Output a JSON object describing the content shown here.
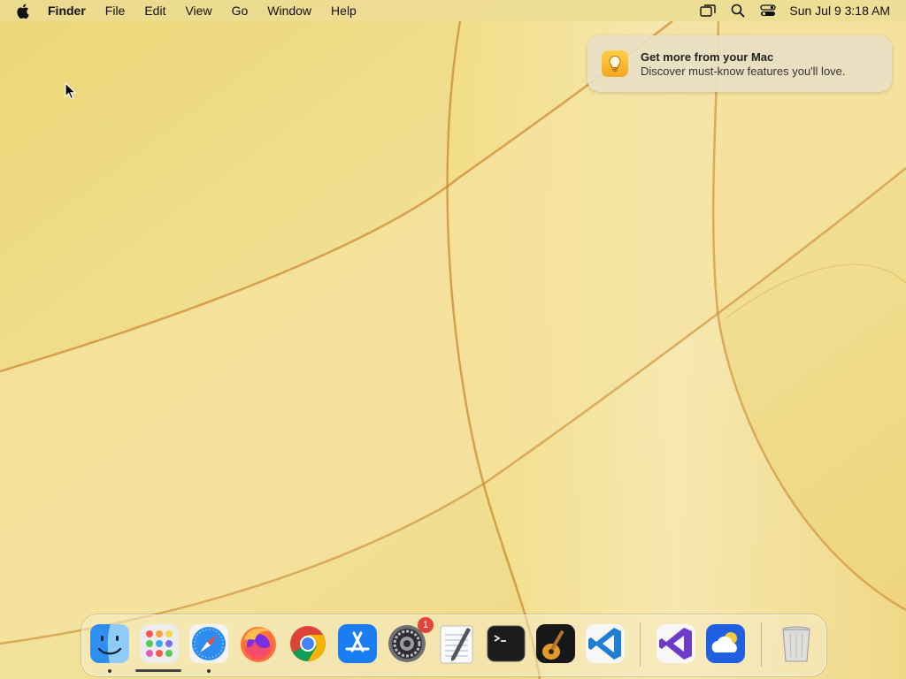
{
  "menubar": {
    "app_name": "Finder",
    "menus": [
      "File",
      "Edit",
      "View",
      "Go",
      "Window",
      "Help"
    ],
    "status_icons": [
      "screen-mirroring-icon",
      "spotlight-search-icon",
      "control-center-icon"
    ],
    "clock": "Sun Jul 9  3:18 AM"
  },
  "notification": {
    "title": "Get more from your Mac",
    "body": "Discover must-know features you'll love.",
    "icon": "lightbulb-icon"
  },
  "dock": {
    "apps": [
      {
        "name": "finder",
        "running": true
      },
      {
        "name": "launchpad",
        "running": false
      },
      {
        "name": "safari",
        "running": true
      },
      {
        "name": "firefox",
        "running": false
      },
      {
        "name": "chrome",
        "running": false
      },
      {
        "name": "app-store",
        "running": false
      },
      {
        "name": "system-settings",
        "running": false,
        "badge": "1"
      },
      {
        "name": "textedit",
        "running": false
      },
      {
        "name": "terminal",
        "running": false
      },
      {
        "name": "garageband",
        "running": false
      },
      {
        "name": "vscode",
        "running": false
      },
      {
        "name": "visual-studio",
        "running": false
      },
      {
        "name": "weather",
        "running": false
      },
      {
        "name": "trash",
        "running": false
      }
    ],
    "settings_badge": "1"
  },
  "colors": {
    "wallpaper_base": "#efd980",
    "wallpaper_stroke": "#c9852e",
    "badge": "#e0443a"
  }
}
